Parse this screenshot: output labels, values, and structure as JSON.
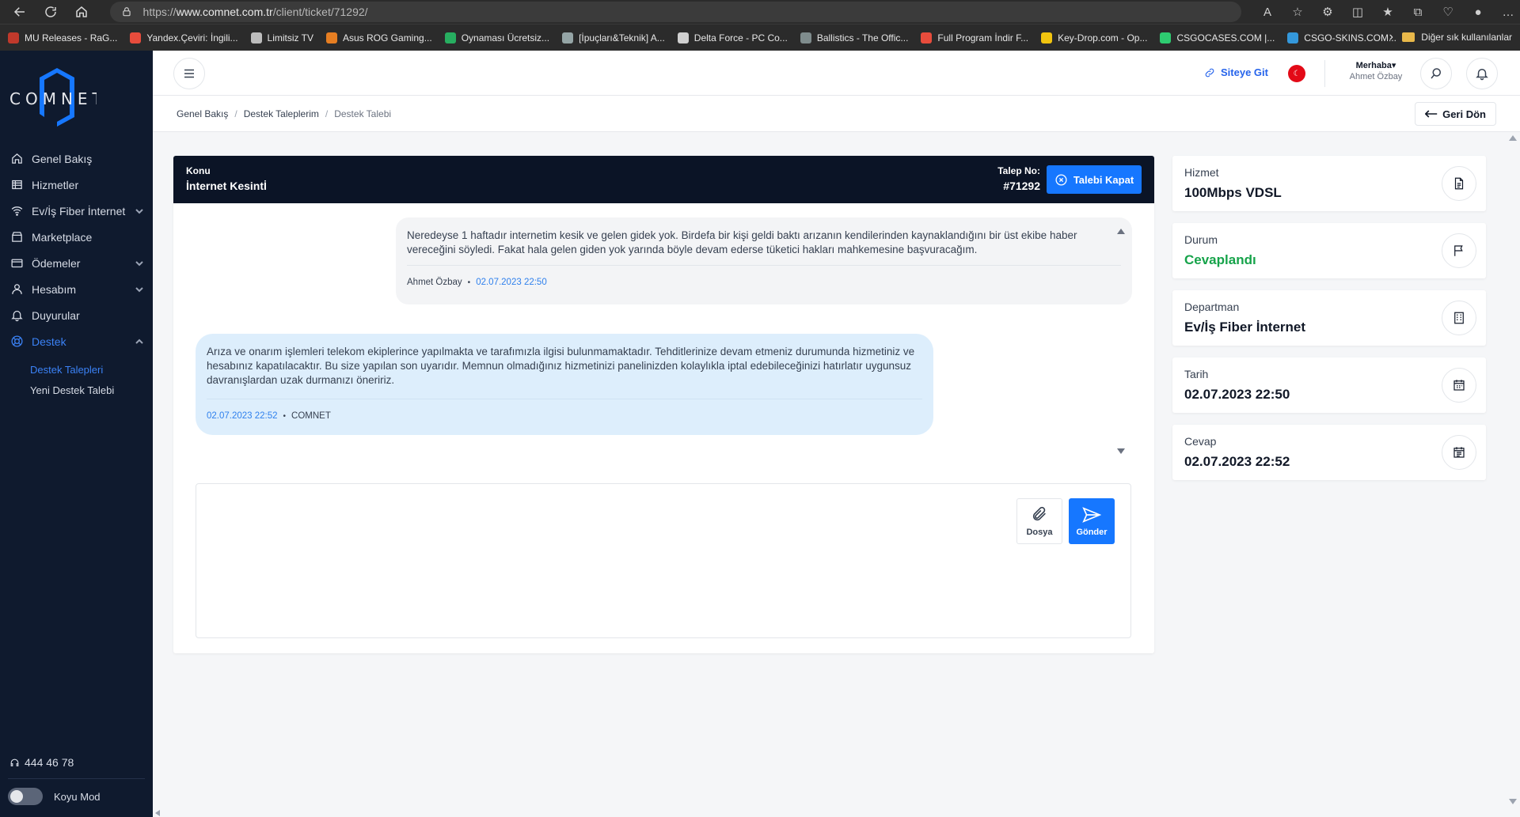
{
  "browser": {
    "url_prefix": "https://",
    "url_domain": "www.comnet.com.tr",
    "url_path": "/client/ticket/71292/",
    "bookmarks": [
      {
        "label": "MU Releases - RaG...",
        "color": "#c0392b"
      },
      {
        "label": "Yandex.Çeviri: İngili...",
        "color": "#e74c3c"
      },
      {
        "label": "Limitsiz TV",
        "color": "#bdbdbd"
      },
      {
        "label": "Asus ROG Gaming...",
        "color": "#e67e22"
      },
      {
        "label": "Oynaması Ücretsiz...",
        "color": "#27ae60"
      },
      {
        "label": "[İpuçları&Teknik] A...",
        "color": "#95a5a6"
      },
      {
        "label": "Delta Force - PC Co...",
        "color": "#d0d0d0"
      },
      {
        "label": "Ballistics - The Offic...",
        "color": "#7f8c8d"
      },
      {
        "label": "Full Program İndir F...",
        "color": "#e74c3c"
      },
      {
        "label": "Key-Drop.com - Op...",
        "color": "#f1c40f"
      },
      {
        "label": "CSGOCASES.COM |...",
        "color": "#2ecc71"
      },
      {
        "label": "CSGO-SKINS.COM...",
        "color": "#3498db"
      }
    ],
    "other_bookmarks": "Diğer sık kullanılanlar"
  },
  "sidebar": {
    "logo_text": "COMNET",
    "items": [
      {
        "label": "Genel Bakış",
        "icon": "home-icon"
      },
      {
        "label": "Hizmetler",
        "icon": "list-icon"
      },
      {
        "label": "Ev/İş Fiber İnternet",
        "icon": "wifi-icon"
      },
      {
        "label": "Marketplace",
        "icon": "store-icon"
      },
      {
        "label": "Ödemeler",
        "icon": "card-icon"
      },
      {
        "label": "Hesabım",
        "icon": "user-icon"
      },
      {
        "label": "Duyurular",
        "icon": "bell-icon"
      },
      {
        "label": "Destek",
        "icon": "support-icon"
      }
    ],
    "sub_items": [
      "Destek Talepleri",
      "Yeni Destek Talebi"
    ],
    "phone": "444 46 78",
    "dark_mode_label": "Koyu Mod"
  },
  "header": {
    "site_link": "Siteye Git",
    "greeting": "Merhaba",
    "user_name": "Ahmet Özbay"
  },
  "breadcrumb": {
    "items": [
      "Genel Bakış",
      "Destek Taleplerim",
      "Destek Talebi"
    ],
    "back_label": "Geri Dön"
  },
  "ticket": {
    "subject_label": "Konu",
    "subject": "İnternet Kesintİ",
    "number_label": "Talep No:",
    "number": "#71292",
    "close_label": "Talebi Kapat",
    "messages": [
      {
        "text": "Neredeyse 1 haftadır internetim kesik ve gelen gidek yok. Birdefa bir kişi geldi baktı arızanın kendilerinden kaynaklandığını bir üst ekibe haber vereceğini söyledi. Fakat hala gelen giden yok yarında böyle devam ederse tüketici hakları mahkemesine başvuracağım.",
        "author": "Ahmet Özbay",
        "time": "02.07.2023 22:50"
      },
      {
        "text": "Arıza ve onarım işlemleri telekom ekiplerince yapılmakta ve tarafımızla ilgisi bulunmamaktadır. Tehditlerinize devam etmeniz durumunda hizmetiniz ve hesabınız kapatılacaktır. Bu size yapılan son uyarıdır. Memnun olmadığınız hizmetinizi panelinizden kolaylıkla iptal edebileceğinizi hatırlatır uygunsuz davranışlardan uzak durmanızı öneririz.",
        "author": "COMNET",
        "time": "02.07.2023 22:52"
      }
    ],
    "reply_placeholder": "",
    "attach_label": "Dosya",
    "send_label": "Gönder"
  },
  "info": {
    "service_label": "Hizmet",
    "service_value": "100Mbps VDSL",
    "status_label": "Durum",
    "status_value": "Cevaplandı",
    "status_color": "#16a34a",
    "department_label": "Departman",
    "department_value": "Ev/İş Fiber İnternet",
    "date_label": "Tarih",
    "date_value": "02.07.2023 22:50",
    "reply_label": "Cevap",
    "reply_value": "02.07.2023 22:52"
  },
  "colors": {
    "sidebar_bg": "#0f1a2e",
    "accent": "#1677ff",
    "ticket_header_bg": "#0b1426",
    "incoming_bubble": "#ddeefc"
  }
}
